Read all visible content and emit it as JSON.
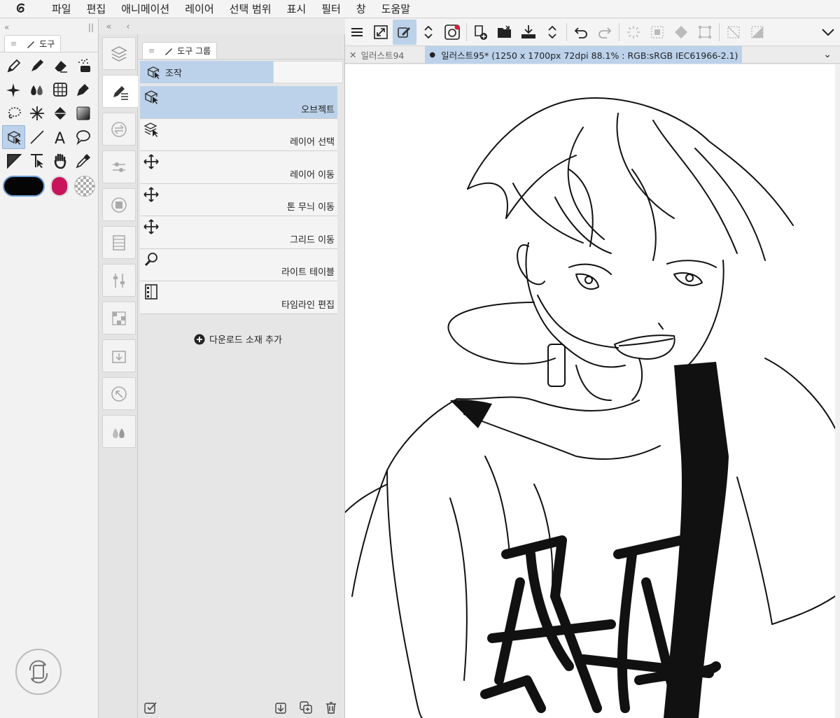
{
  "menu": [
    "파일",
    "편집",
    "애니메이션",
    "레이어",
    "선택 범위",
    "표시",
    "필터",
    "창",
    "도움말"
  ],
  "tool_panel": {
    "tab_label": "도구",
    "tools": [
      "pen-icon",
      "pencil-icon",
      "eraser-icon",
      "airbrush-icon",
      "sparkle-icon",
      "blend-icon",
      "grid-icon",
      "dropper-icon",
      "lasso-icon",
      "auto-select-icon",
      "fill-icon",
      "gradient-icon",
      "object-select-icon",
      "line-icon",
      "text-icon",
      "balloon-icon",
      "ruler-icon",
      "correct-line-icon",
      "hand-icon",
      "eyedropper-icon"
    ],
    "selected_tool": "object-select-icon",
    "main_color": "#050505",
    "sub_color": "#c8145a"
  },
  "group_panel": {
    "tab_label": "도구 그룹",
    "subtool_group": "조작",
    "subtools": [
      {
        "label": "오브젝트",
        "icon": "object-icon",
        "selected": true
      },
      {
        "label": "레이어 선택",
        "icon": "layer-select-icon",
        "selected": false
      },
      {
        "label": "레이어 이동",
        "icon": "move-icon",
        "selected": false
      },
      {
        "label": "톤 무늬 이동",
        "icon": "move-icon",
        "selected": false
      },
      {
        "label": "그리드 이동",
        "icon": "move-icon",
        "selected": false
      },
      {
        "label": "라이트 테이블",
        "icon": "light-table-icon",
        "selected": false
      },
      {
        "label": "타임라인 편집",
        "icon": "timeline-icon",
        "selected": false
      }
    ],
    "add_material": "다운로드 소재 추가"
  },
  "document_tabs": [
    {
      "label": "일러스트94",
      "active": false
    },
    {
      "label": "일러스트95* (1250 x 1700px 72dpi 88.1% : RGB:sRGB IEC61966-2.1)",
      "active": true
    }
  ],
  "colors": {
    "accent": "#bcd2ea",
    "selected_border": "#8fb0d6"
  }
}
